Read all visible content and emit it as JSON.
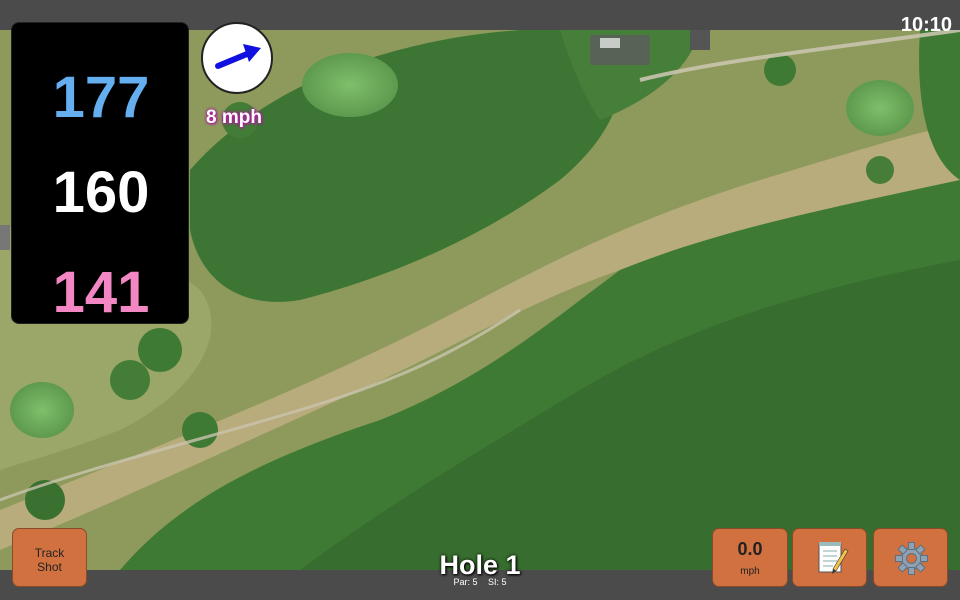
{
  "status": {
    "time": "10:10"
  },
  "distances": {
    "back": "177",
    "middle": "160",
    "front": "141"
  },
  "wind": {
    "speed_label": "8 mph",
    "arrow_icon": "wind-direction-arrow-icon"
  },
  "hole": {
    "title": "Hole 1",
    "par": "Par: 5",
    "stroke_index": "SI: 5"
  },
  "buttons": {
    "track_shot_line1": "Track",
    "track_shot_line2": "Shot",
    "speed_value": "0.0",
    "speed_unit": "mph",
    "notes_icon": "notepad-icon",
    "settings_icon": "gear-icon"
  },
  "colors": {
    "back_distance": "#65aef0",
    "middle_distance": "#ffffff",
    "front_distance": "#f287c4",
    "button": "#d0713f",
    "wind_arrow": "#1010e0"
  }
}
